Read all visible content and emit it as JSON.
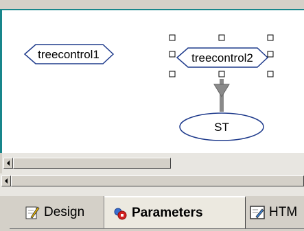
{
  "window": {
    "icons": {
      "design_tab": "design-pencil-icon",
      "parameters_tab": "parameters-icon",
      "html_tab": "html-edit-icon",
      "scroll_left": "scroll-left-arrow-icon"
    }
  },
  "diagram": {
    "nodes": [
      {
        "label": "treecontrol1",
        "shape": "hexagon",
        "selected": false
      },
      {
        "label": "treecontrol2",
        "shape": "hexagon",
        "selected": true
      },
      {
        "label": "ST",
        "shape": "ellipse",
        "selected": false
      }
    ],
    "edges": [
      {
        "from": "treecontrol2",
        "to": "ST"
      }
    ],
    "colors": {
      "node_stroke": "#1f3b8c",
      "edge": "#8a8a8a",
      "frame": "#18868b"
    }
  },
  "tabs": [
    {
      "label": "Design",
      "active": false
    },
    {
      "label": "Parameters",
      "active": true
    },
    {
      "label": "HTM",
      "active": false
    }
  ]
}
